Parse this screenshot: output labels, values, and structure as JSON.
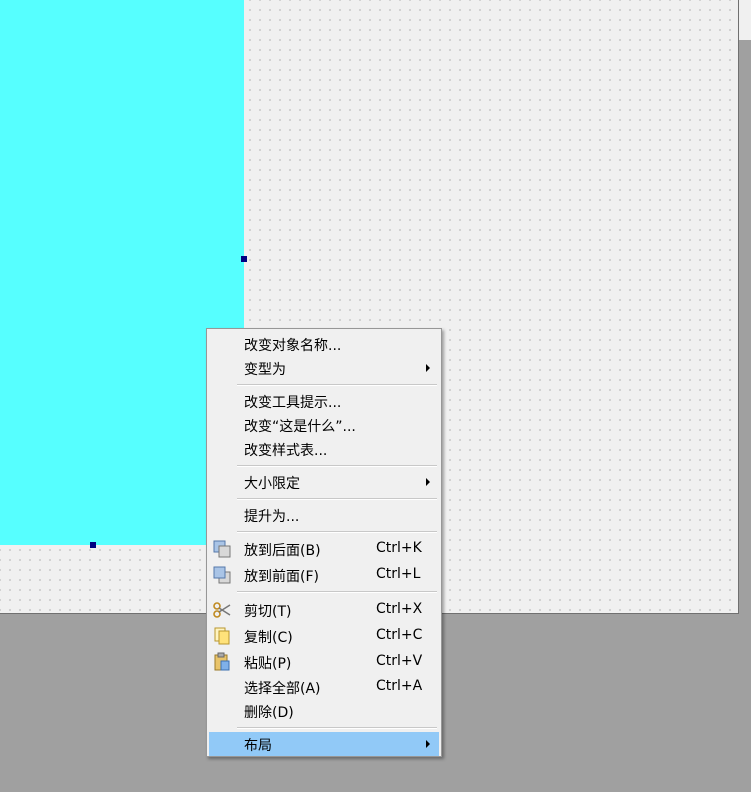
{
  "menu": {
    "items": [
      {
        "label": "改变对象名称...",
        "shortcut": "",
        "submenu": false
      },
      {
        "label": "变型为",
        "shortcut": "",
        "submenu": true
      },
      {
        "label": "改变工具提示...",
        "shortcut": "",
        "submenu": false
      },
      {
        "label": "改变“这是什么”...",
        "shortcut": "",
        "submenu": false
      },
      {
        "label": "改变样式表...",
        "shortcut": "",
        "submenu": false
      },
      {
        "label": "大小限定",
        "shortcut": "",
        "submenu": true
      },
      {
        "label": "提升为...",
        "shortcut": "",
        "submenu": false
      },
      {
        "label": "放到后面(B)",
        "shortcut": "Ctrl+K",
        "icon": "send-to-back-icon"
      },
      {
        "label": "放到前面(F)",
        "shortcut": "Ctrl+L",
        "icon": "bring-to-front-icon"
      },
      {
        "label": "剪切(T)",
        "shortcut": "Ctrl+X",
        "icon": "scissors-icon"
      },
      {
        "label": "复制(C)",
        "shortcut": "Ctrl+C",
        "icon": "copy-icon"
      },
      {
        "label": "粘贴(P)",
        "shortcut": "Ctrl+V",
        "icon": "paste-icon"
      },
      {
        "label": "选择全部(A)",
        "shortcut": "Ctrl+A"
      },
      {
        "label": "删除(D)",
        "shortcut": ""
      },
      {
        "label": "布局",
        "shortcut": "",
        "submenu": true,
        "highlighted": true
      }
    ]
  },
  "colors": {
    "widget": "#56ffff",
    "form_background": "#f0f0f0",
    "outside_area": "#a0a0a0",
    "menu_highlight": "#91c9f7",
    "selection_handle": "#000080"
  }
}
